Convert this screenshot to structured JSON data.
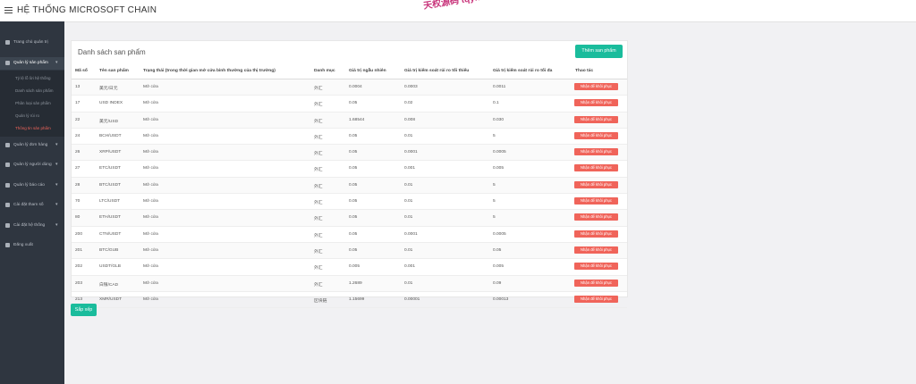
{
  "header": {
    "title": "HỆ THỐNG MICROSOFT CHAIN",
    "watermark": "天权源码 tqym"
  },
  "sidebar": {
    "items": [
      {
        "label": "Trang chủ quản trị",
        "icon": "dashboard-icon"
      },
      {
        "label": "Quản lý sản phẩm",
        "icon": "box-icon",
        "expanded": true
      },
      {
        "label": "Quản lý đơn hàng",
        "icon": "orders-icon"
      },
      {
        "label": "Quản lý người dùng",
        "icon": "user-icon"
      },
      {
        "label": "Quản lý báo cáo",
        "icon": "report-icon"
      },
      {
        "label": "Cài đặt tham số",
        "icon": "sliders-icon"
      },
      {
        "label": "Cài đặt hệ thống",
        "icon": "gear-icon"
      },
      {
        "label": "Đăng xuất",
        "icon": "logout-icon"
      }
    ],
    "sub_items": [
      {
        "label": "Tỷ lệ lỗ lời hệ thống"
      },
      {
        "label": "Danh sách sản phẩm"
      },
      {
        "label": "Phân loại sản phẩm"
      },
      {
        "label": "Quản lý rủi ro"
      },
      {
        "label": "Thông tin sản phẩm",
        "active": true
      }
    ]
  },
  "main": {
    "card_title": "Danh sách san phẩm",
    "add_button": "Thêm san phẩm",
    "sort_button": "Sắp xếp",
    "columns": [
      "Mã số",
      "Tên san phẩm",
      "Trạng thái (trong thời gian mở cửa bình thường của thị trường)",
      "Danh mục",
      "Giá trị ngẫu nhiên",
      "Giá trị kiểm soát rủi ro tối thiểu",
      "Giá trị kiểm soát rủi ro tối đa",
      "Thao tác"
    ],
    "action_label": "Nhận để khôi phục",
    "rows": [
      {
        "id": "13",
        "name": "美元/日元",
        "status": "Mở cửa",
        "category": "外汇",
        "random": "0.0004",
        "min": "0.0003",
        "max": "0.0011"
      },
      {
        "id": "17",
        "name": "USD INDEX",
        "status": "Mở cửa",
        "category": "外汇",
        "random": "0.05",
        "min": "0.02",
        "max": "0.1"
      },
      {
        "id": "22",
        "name": "美元/USD",
        "status": "Mở cửa",
        "category": "外汇",
        "random": "1.68544",
        "min": "0.008",
        "max": "0.030"
      },
      {
        "id": "24",
        "name": "BCH/USDT",
        "status": "Mở cửa",
        "category": "外汇",
        "random": "0.05",
        "min": "0.01",
        "max": "5"
      },
      {
        "id": "26",
        "name": "XRP/USDT",
        "status": "Mở cửa",
        "category": "外汇",
        "random": "0.05",
        "min": "0.0001",
        "max": "0.0005"
      },
      {
        "id": "27",
        "name": "ETC/USDT",
        "status": "Mở cửa",
        "category": "外汇",
        "random": "0.05",
        "min": "0.001",
        "max": "0.005"
      },
      {
        "id": "28",
        "name": "BTC/USDT",
        "status": "Mở cửa",
        "category": "外汇",
        "random": "0.05",
        "min": "0.01",
        "max": "5"
      },
      {
        "id": "70",
        "name": "LTC/USDT",
        "status": "Mở cửa",
        "category": "外汇",
        "random": "0.05",
        "min": "0.01",
        "max": "5"
      },
      {
        "id": "80",
        "name": "ETH/USDT",
        "status": "Mở cửa",
        "category": "外汇",
        "random": "0.05",
        "min": "0.01",
        "max": "5"
      },
      {
        "id": "200",
        "name": "CTN/USDT",
        "status": "Mở cửa",
        "category": "外汇",
        "random": "0.05",
        "min": "0.0001",
        "max": "0.0005"
      },
      {
        "id": "201",
        "name": "BTC/GUB",
        "status": "Mở cửa",
        "category": "外汇",
        "random": "0.05",
        "min": "0.01",
        "max": "0.05"
      },
      {
        "id": "202",
        "name": "USDT/GLB",
        "status": "Mở cửa",
        "category": "外汇",
        "random": "0.005",
        "min": "0.001",
        "max": "0.005"
      },
      {
        "id": "203",
        "name": "白银/CAD",
        "status": "Mở cửa",
        "category": "外汇",
        "random": "1.2689",
        "min": "0.01",
        "max": "0.09"
      },
      {
        "id": "213",
        "name": "XMR/USDT",
        "status": "Mở cửa",
        "category": "区块链",
        "random": "1.15699",
        "min": "0.00001",
        "max": "0.00013"
      }
    ]
  },
  "colors": {
    "accent": "#1abc9c",
    "danger": "#f0645a",
    "sidebar_bg": "#2f3640"
  }
}
